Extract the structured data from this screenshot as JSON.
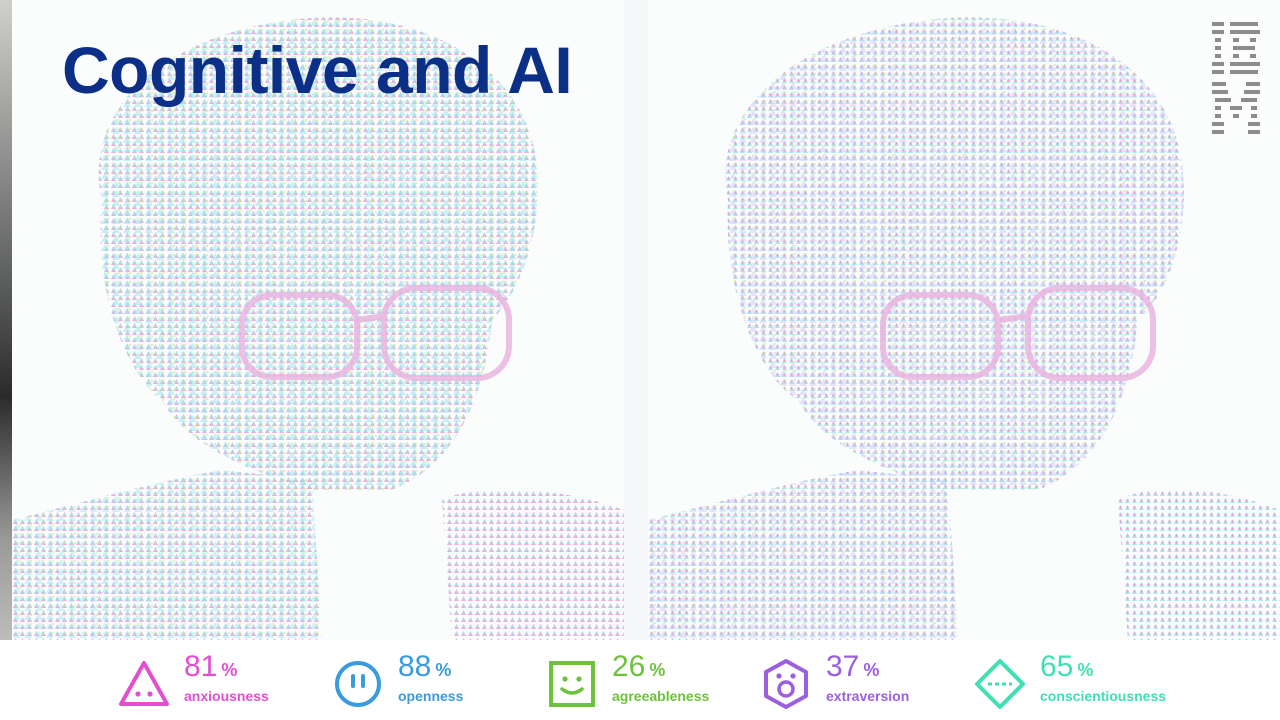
{
  "slide": {
    "title": "Cognitive and AI",
    "logo_name": "IBM",
    "logo_icon": "ibm-striped-logo-icon",
    "colors": {
      "title": "#0b2f86",
      "dot_palette": [
        "#9be6ef",
        "#f29ad6",
        "#c9ee7a",
        "#cfc8f6"
      ]
    }
  },
  "metrics": [
    {
      "value": "81",
      "unit": "%",
      "label": "anxiousness",
      "icon": "triangle-face-icon",
      "color": "#e24fd0"
    },
    {
      "value": "88",
      "unit": "%",
      "label": "openness",
      "icon": "circle-face-icon",
      "color": "#3a9be0"
    },
    {
      "value": "26",
      "unit": "%",
      "label": "agreeableness",
      "icon": "square-face-icon",
      "color": "#6cc23a"
    },
    {
      "value": "37",
      "unit": "%",
      "label": "extraversion",
      "icon": "hexagon-face-icon",
      "color": "#9b5fe0"
    },
    {
      "value": "65",
      "unit": "%",
      "label": "conscientiousness",
      "icon": "diamond-face-icon",
      "color": "#3fe0b4"
    }
  ]
}
